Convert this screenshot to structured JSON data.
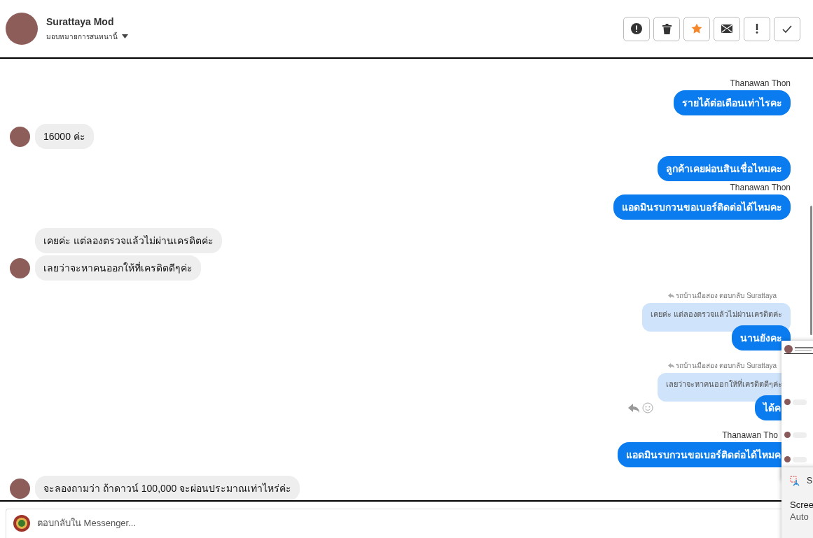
{
  "header": {
    "name": "Surattaya Mod",
    "assign_label": "มอบหมายการสนทนานี้",
    "actions": [
      {
        "kind": "spam",
        "on": false
      },
      {
        "kind": "delete",
        "on": false
      },
      {
        "kind": "star",
        "on": true
      },
      {
        "kind": "unread",
        "on": false
      },
      {
        "kind": "important",
        "on": false
      },
      {
        "kind": "done",
        "on": false
      }
    ]
  },
  "messages": [
    {
      "kind": "sender",
      "text": "Thanawan Thon"
    },
    {
      "kind": "outgoing",
      "text": "รายได้ต่อเดือนเท่าไรคะ",
      "hovered": false,
      "cut": false
    },
    {
      "kind": "incoming",
      "text": "16000 ค่ะ",
      "avatar": true
    },
    {
      "kind": "outgoing",
      "text": "ลูกค้าเคยผ่อนสินเชื่อไหมคะ",
      "hovered": false,
      "cut": false
    },
    {
      "kind": "sender",
      "text": "Thanawan Thon"
    },
    {
      "kind": "outgoing",
      "text": "แอดมินรบกวนขอเบอร์ติดต่อได้ไหมคะ",
      "hovered": false,
      "cut": false
    },
    {
      "kind": "incoming",
      "text": "เคยค่ะ แต่ลองตรวจแล้วไม่ผ่านเครดิตค่ะ",
      "avatar": false
    },
    {
      "kind": "incoming",
      "text": "เลยว่าจะหาคนออกให้ที่เครดิตดีๆค่ะ",
      "avatar": true
    },
    {
      "kind": "reply_note",
      "text": "รถบ้านมือสอง ตอบกลับ Surattaya"
    },
    {
      "kind": "quote",
      "text": "เคยค่ะ แต่ลองตรวจแล้วไม่ผ่านเครดิตค่ะ"
    },
    {
      "kind": "outgoing",
      "text": "นานยังคะ",
      "hovered": false,
      "cut": false
    },
    {
      "kind": "reply_note",
      "text": "รถบ้านมือสอง ตอบกลับ Surattaya"
    },
    {
      "kind": "quote",
      "text": "เลยว่าจะหาคนออกให้ที่เครดิตดีๆค่ะ"
    },
    {
      "kind": "outgoing",
      "text": "ได้ค",
      "hovered": true,
      "cut": true
    },
    {
      "kind": "sender",
      "text": "Thanawan Tho",
      "cut": true
    },
    {
      "kind": "outgoing",
      "text": "แอดมินรบกวนขอเบอร์ติดต่อได้ไหมค",
      "hovered": false,
      "cut": true
    },
    {
      "kind": "incoming",
      "text": "จะลองถามว่า ถ้าดาวน์ 100,000 จะผ่อนประมาณเท่าไหร่ค่ะ",
      "avatar": true
    }
  ],
  "composer": {
    "placeholder": "ตอบกลับใน Messenger..."
  },
  "notification": {
    "app": "S",
    "title": "Scree",
    "body": "Auto"
  }
}
